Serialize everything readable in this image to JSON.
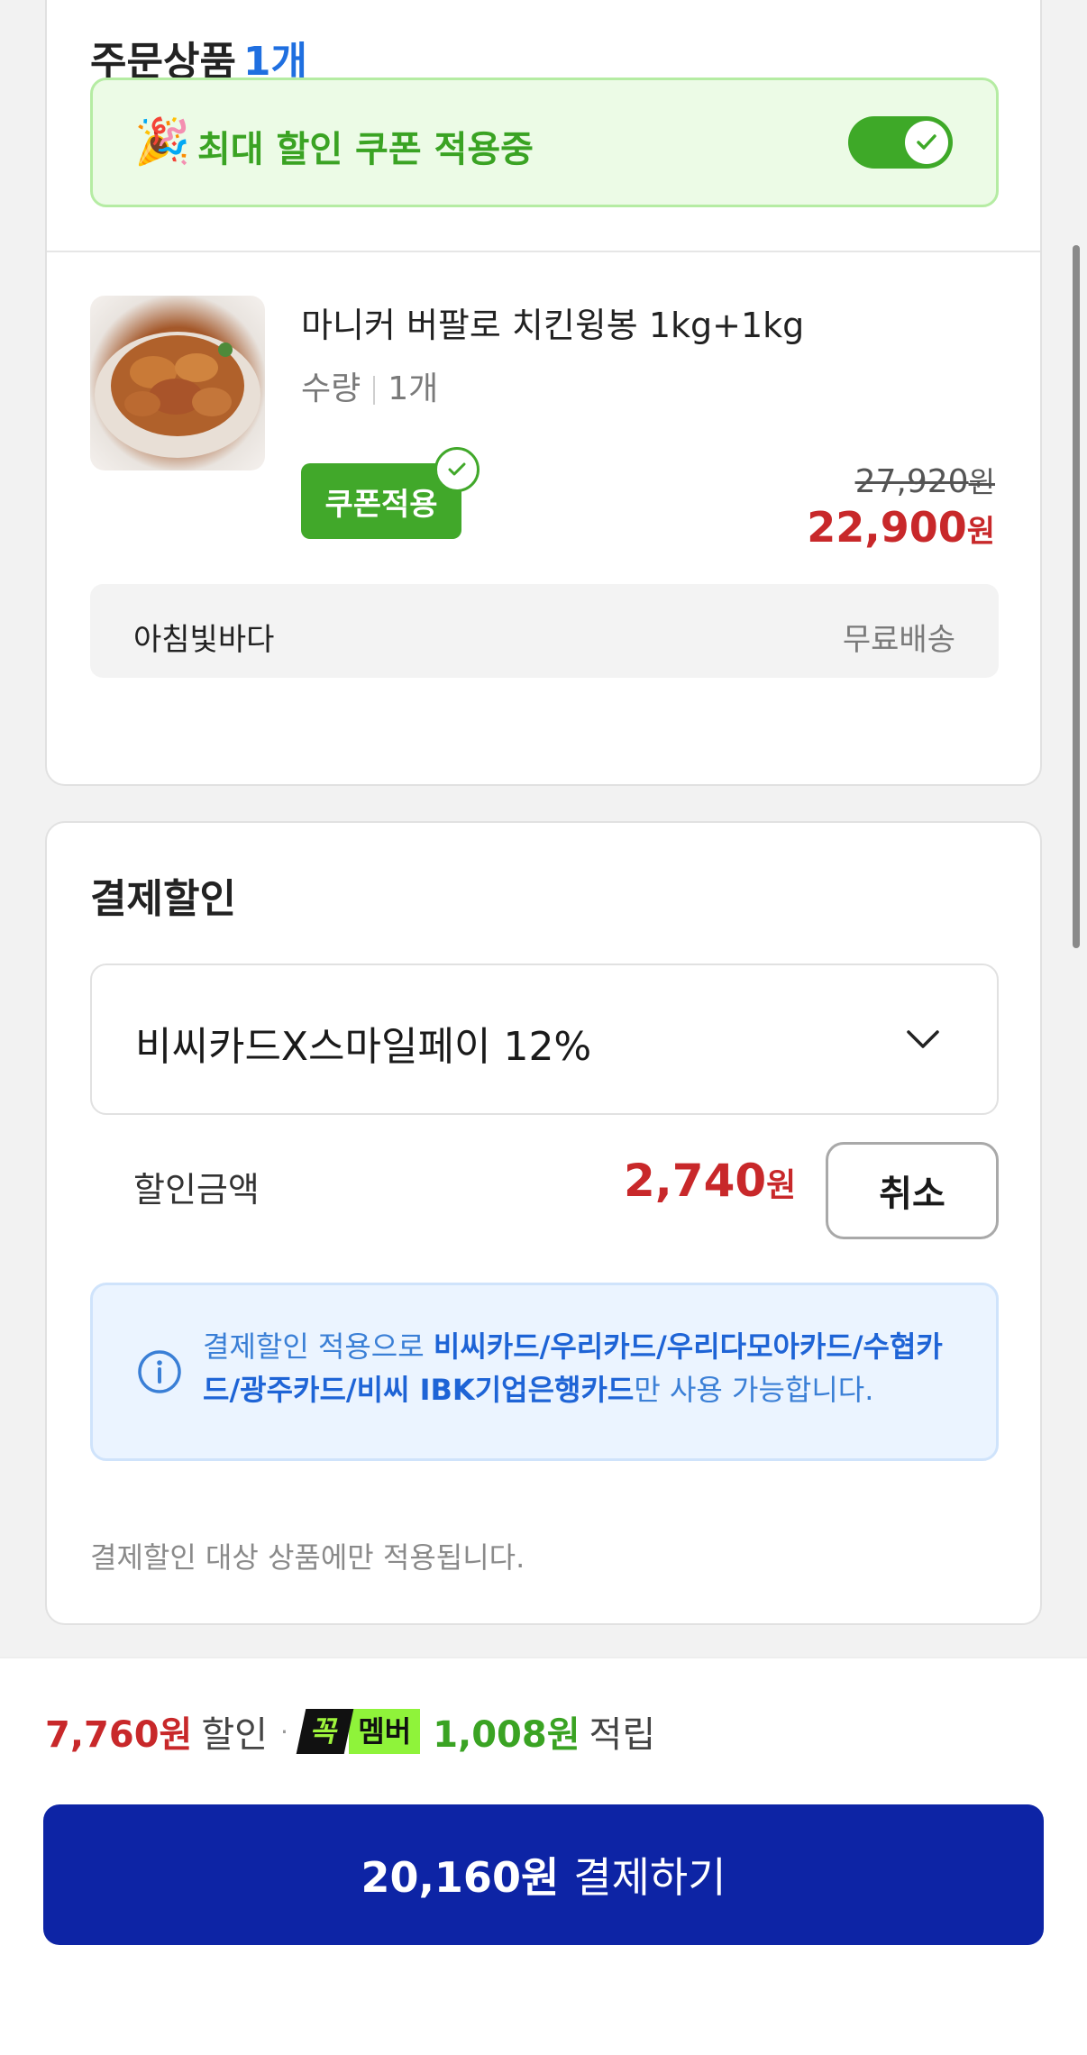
{
  "order": {
    "title": "주문상품",
    "count": "1개",
    "coupon_banner_text": "최대 할인 쿠폰 적용중",
    "coupon_toggle_on": true,
    "product": {
      "name": "마니커 버팔로 치킨윙봉 1kg+1kg",
      "qty_label": "수량",
      "qty_value": "1개",
      "coupon_badge": "쿠폰적용",
      "original_price": "27,920",
      "sale_price": "22,900",
      "currency": "원"
    },
    "seller": "아침빛바다",
    "shipping": "무료배송"
  },
  "payment_discount": {
    "title": "결제할인",
    "selected_card": "비씨카드X스마일페이 12%",
    "discount_label": "할인금액",
    "discount_amount": "2,740",
    "currency": "원",
    "cancel_label": "취소",
    "info_prefix": "결제할인 적용으로 ",
    "info_bold": "비씨카드/우리카드/우리다모아카드/수협카드/광주카드/비씨 IBK기업은행카드",
    "info_suffix": "만 사용 가능합니다.",
    "note": "결제할인 대상 상품에만 적용됩니다."
  },
  "bottom": {
    "discount_total": "7,760원",
    "discount_word": "할인",
    "member_badge_a": "꼭",
    "member_badge_b": "멤버",
    "points": "1,008원",
    "points_word": "적립",
    "pay_amount": "20,160원",
    "pay_label": "결제하기"
  },
  "colors": {
    "accent_blue": "#1f6fe0",
    "price_red": "#c8282a",
    "coupon_green": "#41a82a",
    "pay_button": "#0d24a5"
  }
}
